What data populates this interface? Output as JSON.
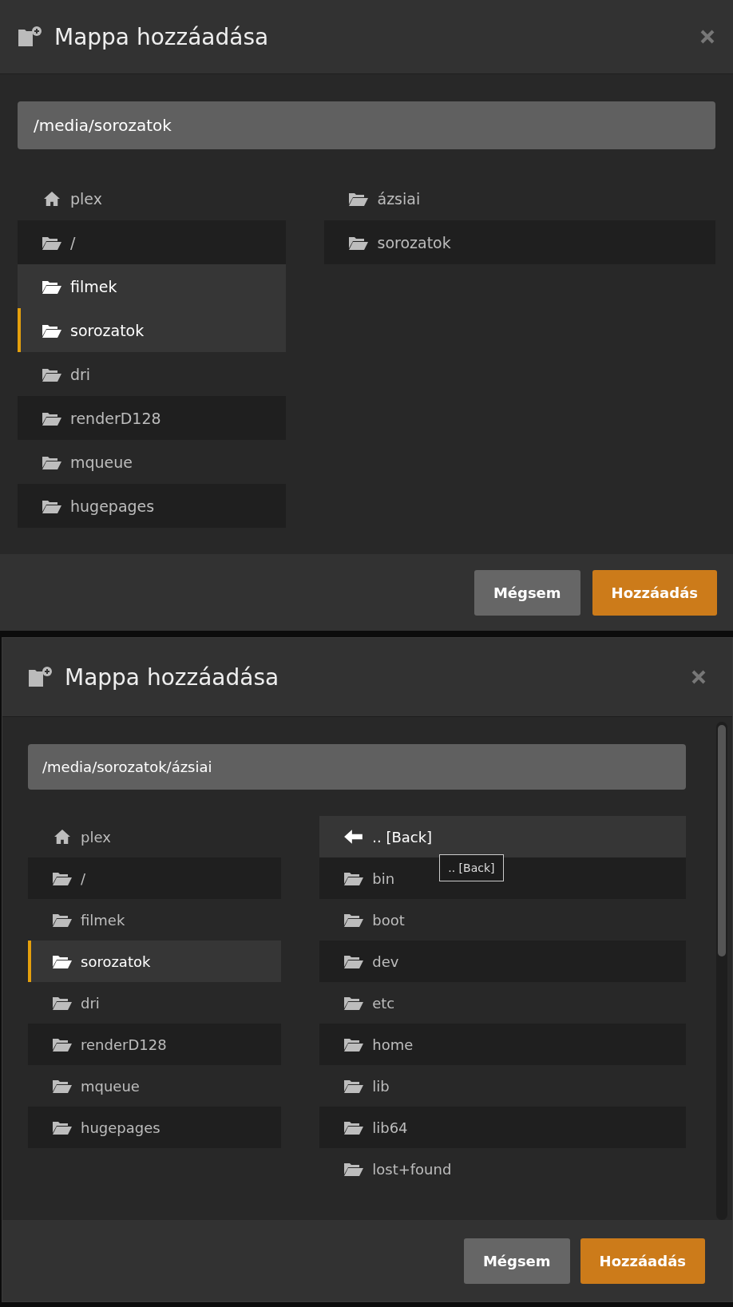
{
  "dialogs": [
    {
      "title": "Mappa hozzáadása",
      "path": "/media/sorozatok",
      "scrollable": false,
      "places": [
        {
          "label": "plex",
          "kind": "home",
          "selected": false,
          "hovered": false
        },
        {
          "label": "/",
          "kind": "folder",
          "selected": false,
          "hovered": false
        },
        {
          "label": "filmek",
          "kind": "folder",
          "selected": false,
          "hovered": true
        },
        {
          "label": "sorozatok",
          "kind": "folder",
          "selected": true,
          "hovered": false
        },
        {
          "label": "dri",
          "kind": "folder",
          "selected": false,
          "hovered": false
        },
        {
          "label": "renderD128",
          "kind": "folder",
          "selected": false,
          "hovered": false
        },
        {
          "label": "mqueue",
          "kind": "folder",
          "selected": false,
          "hovered": false
        },
        {
          "label": "hugepages",
          "kind": "folder",
          "selected": false,
          "hovered": false
        }
      ],
      "folders": [
        {
          "label": "ázsiai",
          "kind": "folder",
          "hovered": false
        },
        {
          "label": "sorozatok",
          "kind": "folder",
          "hovered": false
        }
      ],
      "buttons": [
        {
          "label": "Mégsem",
          "kind": "secondary"
        },
        {
          "label": "Hozzáadás",
          "kind": "primary"
        }
      ]
    },
    {
      "title": "Mappa hozzáadása",
      "path": "/media/sorozatok/ázsiai",
      "scrollable": true,
      "places": [
        {
          "label": "plex",
          "kind": "home",
          "selected": false,
          "hovered": false
        },
        {
          "label": "/",
          "kind": "folder",
          "selected": false,
          "hovered": false
        },
        {
          "label": "filmek",
          "kind": "folder",
          "selected": false,
          "hovered": false
        },
        {
          "label": "sorozatok",
          "kind": "folder",
          "selected": true,
          "hovered": false
        },
        {
          "label": "dri",
          "kind": "folder",
          "selected": false,
          "hovered": false
        },
        {
          "label": "renderD128",
          "kind": "folder",
          "selected": false,
          "hovered": false
        },
        {
          "label": "mqueue",
          "kind": "folder",
          "selected": false,
          "hovered": false
        },
        {
          "label": "hugepages",
          "kind": "folder",
          "selected": false,
          "hovered": false
        }
      ],
      "folders": [
        {
          "label": ".. [Back]",
          "kind": "back",
          "hovered": true,
          "tooltip": ".. [Back]"
        },
        {
          "label": "bin",
          "kind": "folder",
          "hovered": false
        },
        {
          "label": "boot",
          "kind": "folder",
          "hovered": false
        },
        {
          "label": "dev",
          "kind": "folder",
          "hovered": false
        },
        {
          "label": "etc",
          "kind": "folder",
          "hovered": false
        },
        {
          "label": "home",
          "kind": "folder",
          "hovered": false
        },
        {
          "label": "lib",
          "kind": "folder",
          "hovered": false
        },
        {
          "label": "lib64",
          "kind": "folder",
          "hovered": false
        },
        {
          "label": "lost+found",
          "kind": "folder",
          "hovered": false
        }
      ],
      "buttons": [
        {
          "label": "Mégsem",
          "kind": "secondary"
        },
        {
          "label": "Hozzáadás",
          "kind": "primary"
        }
      ]
    }
  ]
}
